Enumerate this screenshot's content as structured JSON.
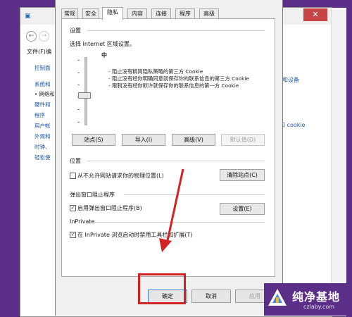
{
  "background_window": {
    "menu": [
      "文件(F)",
      "编"
    ],
    "left_nav": [
      "控制面",
      "系统和",
      "网络和",
      "硬件和",
      "程序",
      "用户帐",
      "外观和",
      "时钟、",
      "轻松使"
    ],
    "left_nav_current": "网络和",
    "right_links": [
      "和设备",
      "和 cookie"
    ]
  },
  "dialog": {
    "tabs": [
      "常规",
      "安全",
      "隐私",
      "内容",
      "连接",
      "程序",
      "高级"
    ],
    "active_tab": "隐私",
    "settings_section": "设置",
    "zone_prompt": "选择 Internet 区域设置。",
    "level": "中",
    "level_desc": [
      "- 阻止没有精简隐私策略的第三方 Cookie",
      "- 阻止没有经你明确同意就保存你的联系信息的第三方 Cookie",
      "- 限制没有经你默许就保存你的联系信息的第一方 Cookie"
    ],
    "buttons": {
      "sites": "站点(S)",
      "import": "导入(I)",
      "advanced": "高级(V)",
      "default": "默认值(D)"
    },
    "location_section": "位置",
    "location_check": "从不允许网站请求你的物理位置(L)",
    "clear_sites": "清除站点(C)",
    "popup_section": "弹出窗口阻止程序",
    "popup_check": "启用弹出窗口阻止程序(B)",
    "popup_settings": "设置(E)",
    "inprivate_section": "InPrivate",
    "inprivate_check": "在 InPrivate 浏览启动时禁用工具栏和扩展(T)",
    "footer": {
      "ok": "确定",
      "cancel": "取消",
      "apply": "应用"
    }
  },
  "watermark": {
    "title": "纯净基地",
    "url": "czlaby.com"
  },
  "colors": {
    "desktop": "#5b2f87",
    "annotation": "#d22222",
    "link": "#1a55a6"
  }
}
